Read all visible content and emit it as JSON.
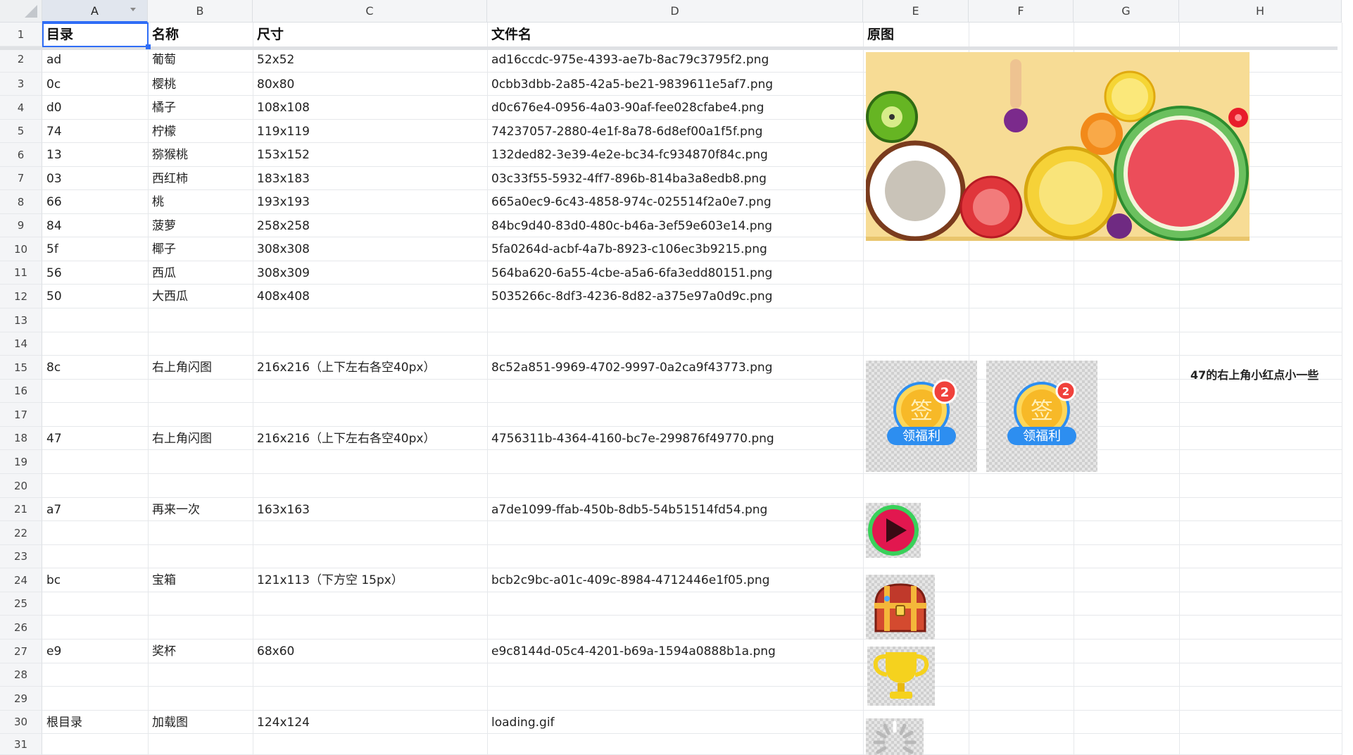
{
  "columns": [
    "A",
    "B",
    "C",
    "D",
    "E",
    "F",
    "G",
    "H"
  ],
  "header_row": {
    "a": "目录",
    "b": "名称",
    "c": "尺寸",
    "d": "文件名",
    "e": "原图"
  },
  "rows": [
    {
      "n": "2",
      "a": "ad",
      "b": "葡萄",
      "c": "52x52",
      "d": "ad16ccdc-975e-4393-ae7b-8ac79c3795f2.png"
    },
    {
      "n": "3",
      "a": "0c",
      "b": "樱桃",
      "c": "80x80",
      "d": "0cbb3dbb-2a85-42a5-be21-9839611e5af7.png"
    },
    {
      "n": "4",
      "a": "d0",
      "b": "橘子",
      "c": "108x108",
      "d": "d0c676e4-0956-4a03-90af-fee028cfabe4.png"
    },
    {
      "n": "5",
      "a": "74",
      "b": "柠檬",
      "c": "119x119",
      "d": "74237057-2880-4e1f-8a78-6d8ef00a1f5f.png"
    },
    {
      "n": "6",
      "a": "13",
      "b": "猕猴桃",
      "c": "153x152",
      "d": "132ded82-3e39-4e2e-bc34-fc934870f84c.png"
    },
    {
      "n": "7",
      "a": "03",
      "b": "西红柿",
      "c": "183x183",
      "d": "03c33f55-5932-4ff7-896b-814ba3a8edb8.png"
    },
    {
      "n": "8",
      "a": "66",
      "b": "桃",
      "c": "193x193",
      "d": "665a0ec9-6c43-4858-974c-025514f2a0e7.png"
    },
    {
      "n": "9",
      "a": "84",
      "b": "菠萝",
      "c": "258x258",
      "d": "84bc9d40-83d0-480c-b46a-3ef59e603e14.png"
    },
    {
      "n": "10",
      "a": "5f",
      "b": "椰子",
      "c": "308x308",
      "d": "5fa0264d-acbf-4a7b-8923-c106ec3b9215.png"
    },
    {
      "n": "11",
      "a": "56",
      "b": "西瓜",
      "c": "308x309",
      "d": "564ba620-6a55-4cbe-a5a6-6fa3edd80151.png"
    },
    {
      "n": "12",
      "a": "50",
      "b": "大西瓜",
      "c": "408x408",
      "d": "5035266c-8df3-4236-8d82-a375e97a0d9c.png"
    },
    {
      "n": "13",
      "a": "",
      "b": "",
      "c": "",
      "d": ""
    },
    {
      "n": "14",
      "a": "",
      "b": "",
      "c": "",
      "d": ""
    },
    {
      "n": "15",
      "a": "8c",
      "b": "右上角闪图",
      "c": "216x216（上下左右各空40px）",
      "d": "8c52a851-9969-4702-9997-0a2ca9f43773.png"
    },
    {
      "n": "16",
      "a": "",
      "b": "",
      "c": "",
      "d": ""
    },
    {
      "n": "17",
      "a": "",
      "b": "",
      "c": "",
      "d": ""
    },
    {
      "n": "18",
      "a": "47",
      "b": "右上角闪图",
      "c": "216x216（上下左右各空40px）",
      "d": "4756311b-4364-4160-bc7e-299876f49770.png"
    },
    {
      "n": "19",
      "a": "",
      "b": "",
      "c": "",
      "d": ""
    },
    {
      "n": "20",
      "a": "",
      "b": "",
      "c": "",
      "d": ""
    },
    {
      "n": "21",
      "a": "a7",
      "b": "再来一次",
      "c": "163x163",
      "d": "a7de1099-ffab-450b-8db5-54b51514fd54.png"
    },
    {
      "n": "22",
      "a": "",
      "b": "",
      "c": "",
      "d": ""
    },
    {
      "n": "23",
      "a": "",
      "b": "",
      "c": "",
      "d": ""
    },
    {
      "n": "24",
      "a": "bc",
      "b": "宝箱",
      "c": "121x113（下方空 15px）",
      "d": "bcb2c9bc-a01c-409c-8984-4712446e1f05.png"
    },
    {
      "n": "25",
      "a": "",
      "b": "",
      "c": "",
      "d": ""
    },
    {
      "n": "26",
      "a": "",
      "b": "",
      "c": "",
      "d": ""
    },
    {
      "n": "27",
      "a": "e9",
      "b": "奖杯",
      "c": "68x60",
      "d": "e9c8144d-05c4-4201-b69a-1594a0888b1a.png"
    },
    {
      "n": "28",
      "a": "",
      "b": "",
      "c": "",
      "d": ""
    },
    {
      "n": "29",
      "a": "",
      "b": "",
      "c": "",
      "d": ""
    },
    {
      "n": "30",
      "a": "根目录",
      "b": "加载图",
      "c": "124x124",
      "d": "loading.gif"
    },
    {
      "n": "31",
      "a": "",
      "b": "",
      "c": "",
      "d": ""
    }
  ],
  "row1_label": "1",
  "note_h15": "47的右上角小红点小一些",
  "badge": {
    "sign_char": "签",
    "count": "2",
    "label": "领福利"
  },
  "colors": {
    "accent": "#2f6df6",
    "badge_red": "#f0413b",
    "coin": "#f7b928",
    "ribbon": "#2d8ef0",
    "play_red": "#e2174f",
    "play_ring": "#39d05a"
  }
}
